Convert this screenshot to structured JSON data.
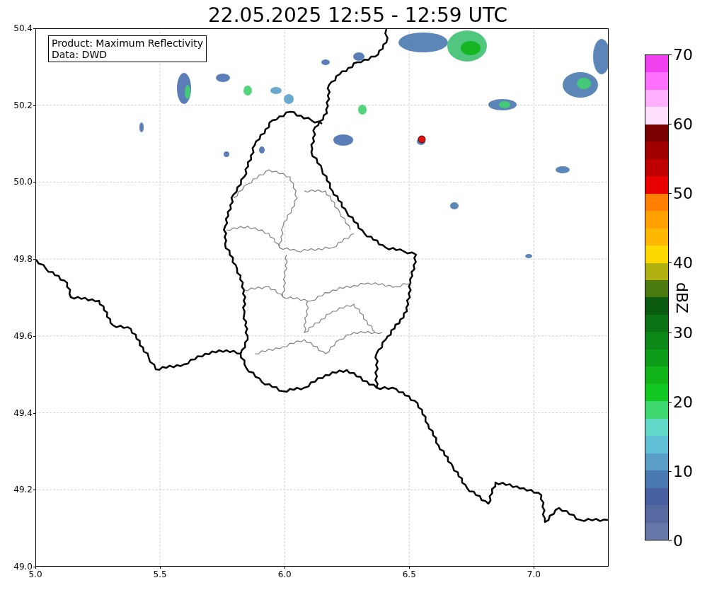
{
  "figure": {
    "title": "22.05.2025 12:55 - 12:59 UTC",
    "x_ticks": [
      "5.0",
      "5.5",
      "6.0",
      "6.5",
      "7.0"
    ],
    "y_ticks": [
      "50.4",
      "50.2",
      "50.0",
      "49.8",
      "49.6",
      "49.4",
      "49.2",
      "49.0"
    ],
    "legend": {
      "lines": [
        "Product: Maximum Reflectivity",
        "Data: DWD"
      ]
    },
    "colorbar": {
      "label": "dBZ",
      "ticks": [
        "70",
        "60",
        "50",
        "40",
        "30",
        "20",
        "10",
        "0"
      ],
      "bins": [
        {
          "color": "#6477a8"
        },
        {
          "color": "#5669a0"
        },
        {
          "color": "#4860a0"
        },
        {
          "color": "#4a78b0"
        },
        {
          "color": "#5a9ec8"
        },
        {
          "color": "#62c0d8"
        },
        {
          "color": "#62d8c8"
        },
        {
          "color": "#3ed870"
        },
        {
          "color": "#10c820"
        },
        {
          "color": "#10b418"
        },
        {
          "color": "#0c9c18"
        },
        {
          "color": "#0c8818"
        },
        {
          "color": "#0a7414"
        },
        {
          "color": "#0a5a10"
        },
        {
          "color": "#4a7a10"
        },
        {
          "color": "#b0b010"
        },
        {
          "color": "#ffd800"
        },
        {
          "color": "#ffb800"
        },
        {
          "color": "#ffa000"
        },
        {
          "color": "#ff8000"
        },
        {
          "color": "#e80000"
        },
        {
          "color": "#c00000"
        },
        {
          "color": "#a00000"
        },
        {
          "color": "#780000"
        },
        {
          "color": "#ffe0ff"
        },
        {
          "color": "#ffb0ff"
        },
        {
          "color": "#ff70ff"
        },
        {
          "color": "#f040f0"
        }
      ]
    }
  }
}
